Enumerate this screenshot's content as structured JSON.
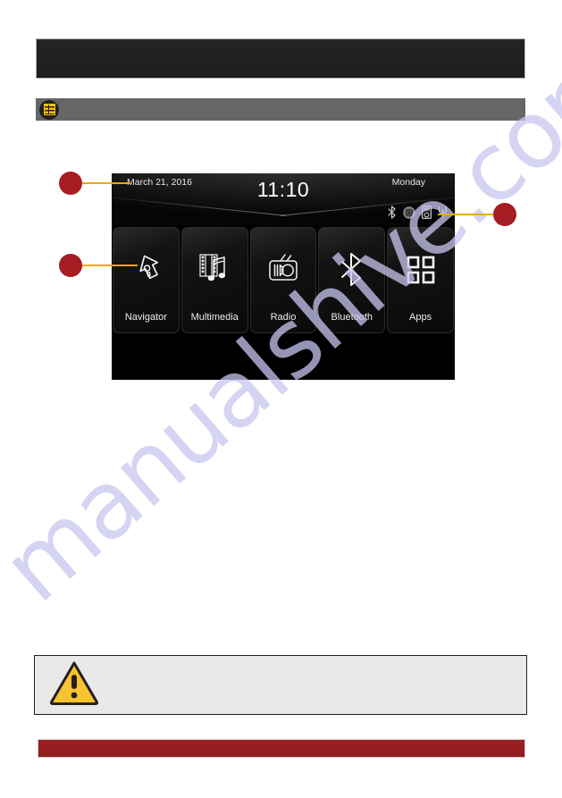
{
  "header": {
    "title": ""
  },
  "section": {
    "icon": "list-table-icon",
    "title": ""
  },
  "device": {
    "status_bar": {
      "date": "March 21, 2016",
      "clock": "11:10",
      "day": "Monday",
      "icons": [
        {
          "name": "bluetooth-icon",
          "label": "Bluetooth"
        },
        {
          "name": "disc-icon",
          "label": "Disc"
        },
        {
          "name": "ipod-icon",
          "label": "iPod"
        },
        {
          "name": "usb-icon",
          "label": "USB"
        }
      ]
    },
    "tiles": [
      {
        "id": "navigator",
        "label": "Navigator",
        "icon": "navigation-arrow-icon"
      },
      {
        "id": "multimedia",
        "label": "Multimedia",
        "icon": "film-music-icon"
      },
      {
        "id": "radio",
        "label": "Radio",
        "icon": "radio-icon"
      },
      {
        "id": "bluetooth",
        "label": "Bluetooth",
        "icon": "bluetooth-icon"
      },
      {
        "id": "apps",
        "label": "Apps",
        "icon": "grid-apps-icon"
      }
    ]
  },
  "callouts": [
    {
      "id": "callout-status-bar",
      "label": "",
      "target": "status-bar"
    },
    {
      "id": "callout-navigator-tile",
      "label": "",
      "target": "navigator-tile"
    },
    {
      "id": "callout-status-icons",
      "label": "",
      "target": "status-icons"
    }
  ],
  "warning": {
    "icon": "warning-triangle-icon",
    "text": ""
  },
  "footer": {
    "title": ""
  },
  "watermark": {
    "text": "manualshive.com"
  },
  "colors": {
    "header_band": "#232021",
    "section_band": "#666666",
    "section_icon_accent": "#fdc500",
    "callout_dot": "#a51c23",
    "callout_leader": "#f0a800",
    "footer_band": "#9c2022",
    "warning_fill": "#f7c331",
    "watermark": "#c9c6f0"
  }
}
